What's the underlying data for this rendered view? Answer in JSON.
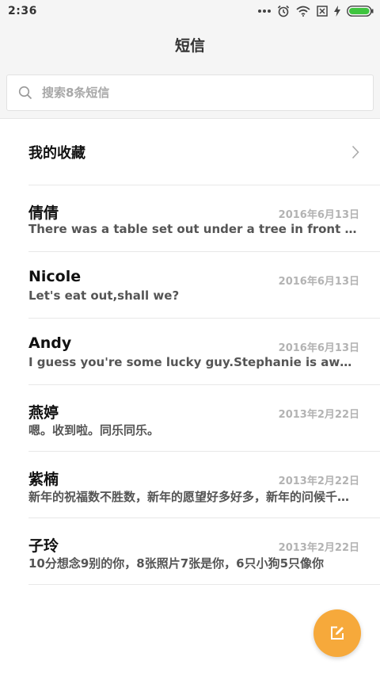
{
  "status_bar": {
    "time": "2:36",
    "icons": [
      "more-dots-icon",
      "alarm-icon",
      "wifi-icon",
      "no-sim-icon",
      "charging-icon",
      "battery-icon"
    ]
  },
  "header": {
    "title": "短信"
  },
  "search": {
    "placeholder": "搜索8条短信"
  },
  "favorites": {
    "label": "我的收藏"
  },
  "messages": [
    {
      "name": "倩倩",
      "date": "2016年6月13日",
      "preview": "There was a table set out under a tree in front of the house"
    },
    {
      "name": "Nicole",
      "date": "2016年6月13日",
      "preview": "Let's eat out,shall we?"
    },
    {
      "name": "Andy",
      "date": "2016年6月13日",
      "preview": "I guess you're some lucky guy.Stephanie is awesome"
    },
    {
      "name": "燕婷",
      "date": "2013年2月22日",
      "preview": "嗯。收到啦。同乐同乐。"
    },
    {
      "name": "紫楠",
      "date": "2013年2月22日",
      "preview": "新年的祝福数不胜数，新年的愿望好多好多，新年的问候千言万语"
    },
    {
      "name": "子玲",
      "date": "2013年2月22日",
      "preview": "10分想念9别的你，8张照片7张是你，6只小狗5只像你"
    }
  ],
  "colors": {
    "accent": "#f6a93b",
    "battery": "#3fc43f"
  },
  "fab": {
    "icon": "compose-icon"
  }
}
